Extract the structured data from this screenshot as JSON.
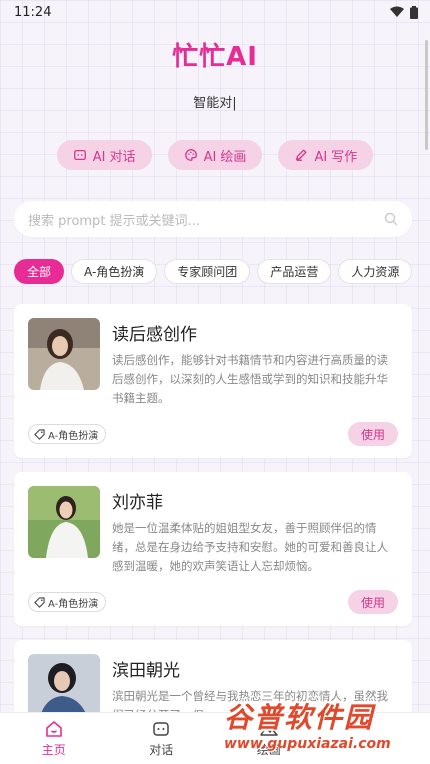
{
  "status_bar": {
    "time": "11:24"
  },
  "header": {
    "title": "忙忙AI",
    "subtitle": "智能对|"
  },
  "modes": [
    {
      "label": "AI 对话",
      "icon": "chat-icon"
    },
    {
      "label": "AI 绘画",
      "icon": "palette-icon"
    },
    {
      "label": "AI 写作",
      "icon": "pen-icon"
    }
  ],
  "search": {
    "placeholder": "搜索 prompt 提示或关键词...",
    "icon": "search-icon"
  },
  "categories": [
    "全部",
    "A-角色扮演",
    "专家顾问团",
    "产品运营",
    "人力资源"
  ],
  "active_category": "全部",
  "cards": [
    {
      "title": "读后感创作",
      "description": "读后感创作，能够针对书籍情节和内容进行高质量的读后感创作，以深刻的人生感悟或学到的知识和技能升华书籍主题。",
      "tag": "A-角色扮演",
      "action": "使用"
    },
    {
      "title": "刘亦菲",
      "description": "她是一位温柔体贴的姐姐型女友，善于照顾伴侣的情绪，总是在身边给予支持和安慰。她的可爱和善良让人感到温暖，她的欢声笑语让人忘却烦恼。",
      "tag": "A-角色扮演",
      "action": "使用"
    },
    {
      "title": "滨田朝光",
      "description": "滨田朝光是一个曾经与我热恋三年的初恋情人，虽然我们已经分开了，但",
      "tag": "",
      "action": ""
    }
  ],
  "bottom_nav": [
    {
      "label": "主页",
      "icon": "home-icon"
    },
    {
      "label": "对话",
      "icon": "chat-bubble-icon"
    },
    {
      "label": "绘画",
      "icon": "image-icon"
    }
  ],
  "watermark": {
    "main": "谷普软件园",
    "url": "www.gupuxiazai.com"
  },
  "colors": {
    "accent": "#e72d95",
    "accent_light": "#f6d2e6"
  }
}
